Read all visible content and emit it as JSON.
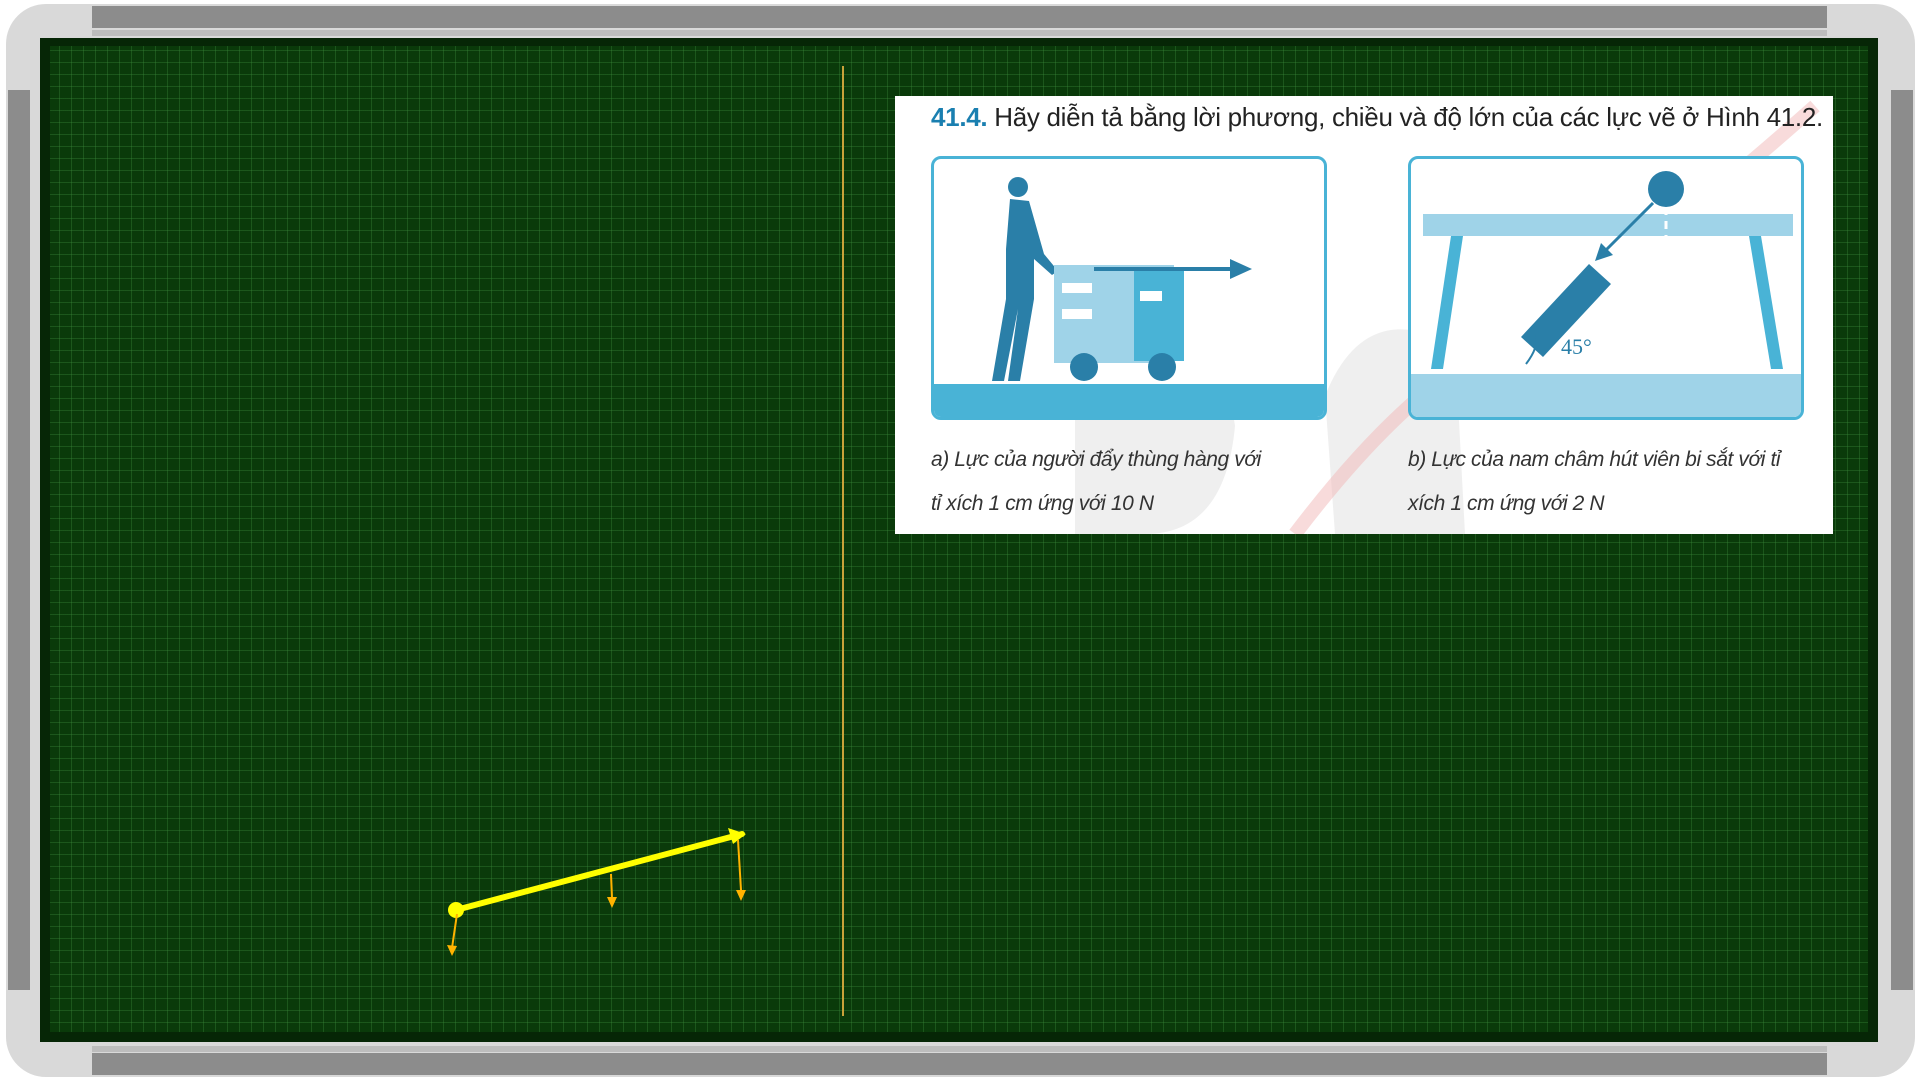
{
  "slide": {
    "question_number": "41.4.",
    "question_text": "Hãy diễn tả bằng lời phương, chiều và độ lớn của các lực vẽ ở Hình 41.2.",
    "figure_a_caption_line1": "a) Lực của người đẩy thùng hàng với",
    "figure_a_caption_line2": "tỉ xích 1 cm ứng với 10 N",
    "figure_b_caption_line1": "b) Lực của nam châm hút viên bi sắt với tỉ",
    "figure_b_caption_line2": "xích 1 cm ứng với 2 N",
    "angle_label": "45°"
  },
  "colors": {
    "board": "#0a3a0a",
    "grid": "#3c8c3c",
    "frame": "#d9d9d9",
    "divider": "#c8a23a",
    "pen_yellow": "#ffff00",
    "pen_orange": "#ffb300",
    "panel_border": "#49b3d6",
    "title_number": "#1a7fb0"
  }
}
